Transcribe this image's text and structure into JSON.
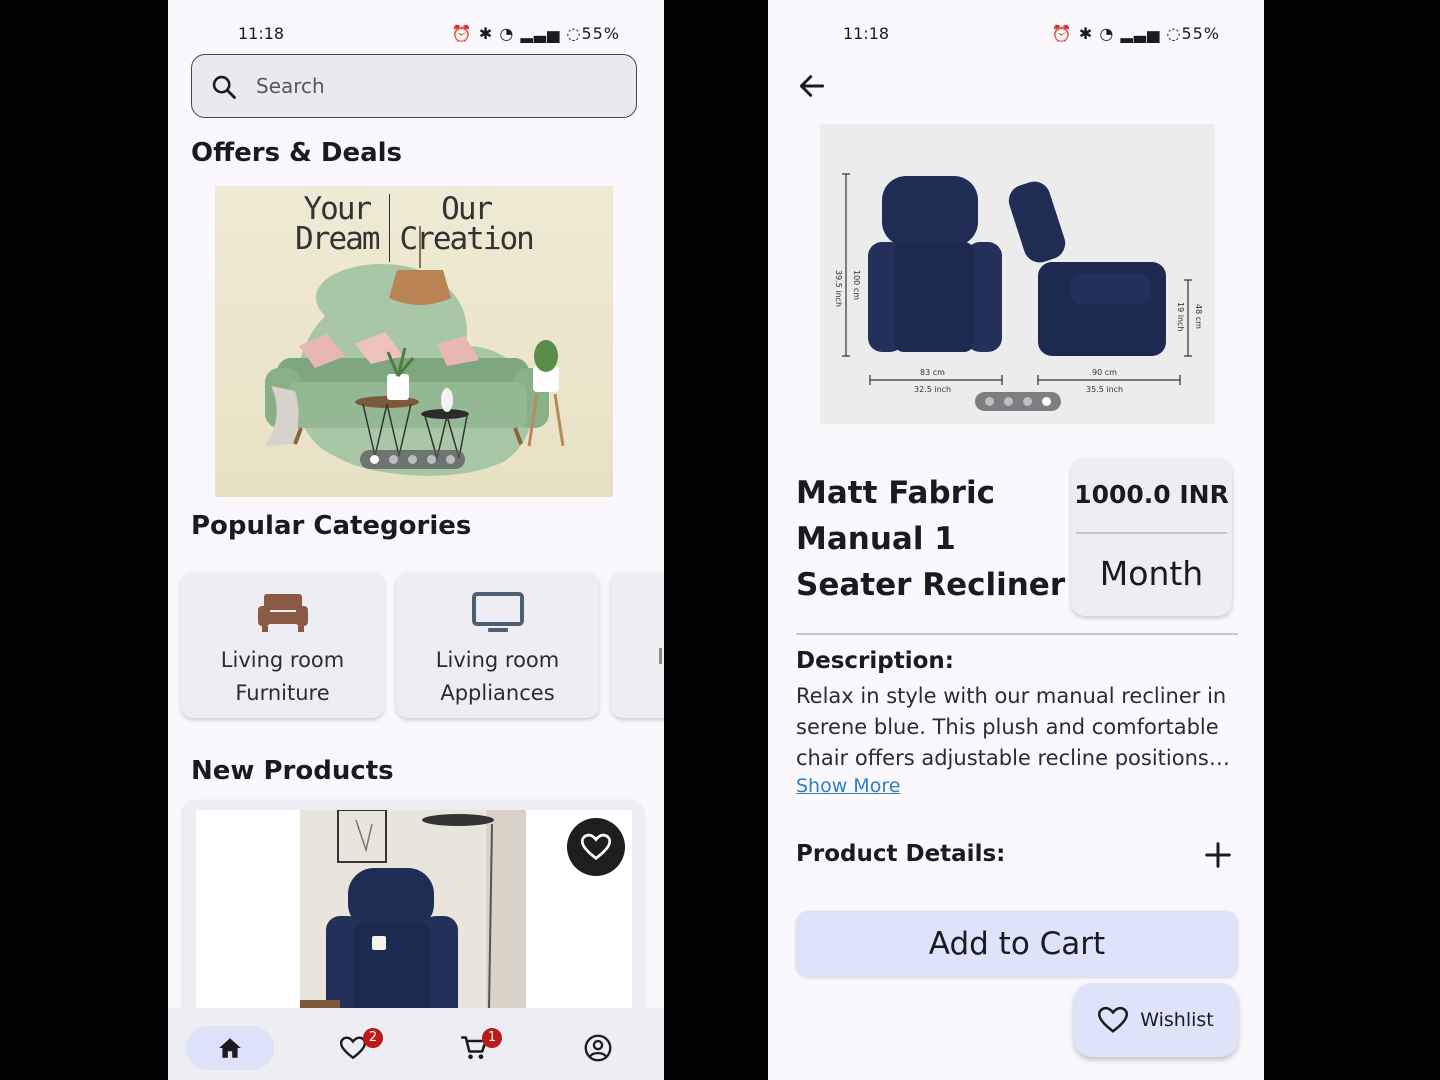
{
  "left_screen": {
    "status": {
      "time": "11:18",
      "battery": "55%"
    },
    "search": {
      "placeholder": "Search"
    },
    "offers_title": "Offers & Deals",
    "banner": {
      "line_left_1": "Your",
      "line_left_2": "Dream",
      "line_right_1": "Our",
      "line_right_2": "Creation"
    },
    "categories_title": "Popular Categories",
    "categories": [
      {
        "label_1": "Living room",
        "label_2": "Furniture",
        "icon": "sofa-icon"
      },
      {
        "label_1": "Living room",
        "label_2": "Appliances",
        "icon": "tv-icon"
      }
    ],
    "new_products_title": "New Products",
    "bottom_nav": {
      "wishlist_badge": "2",
      "cart_badge": "1"
    }
  },
  "right_screen": {
    "status": {
      "time": "11:18",
      "battery": "55%"
    },
    "hero_dims": {
      "height_cm": "100 cm",
      "height_inch": "39.5 inch",
      "width_cm": "83 cm",
      "width_inch": "32.5 inch",
      "depth_cm": "90 cm",
      "depth_inch": "35.5 inch",
      "seat_cm": "48 cm",
      "seat_inch": "19 inch"
    },
    "product": {
      "title": "Matt Fabric Manual 1 Seater Recliner",
      "price": "1000.0 INR",
      "period": "Month"
    },
    "description": {
      "title": "Description:",
      "text": "Relax in style with our manual recliner in serene blue. This plush and comfortable chair offers adjustable recline positions for ultimate relaxation.",
      "show_more": "Show More"
    },
    "details_title": "Product Details:",
    "add_to_cart": "Add to Cart",
    "wishlist": "Wishlist"
  },
  "colors": {
    "background": "#faf8fd",
    "surface": "#eeedf4",
    "primary_container": "#dde3f8",
    "badge": "#ba1a1a",
    "link": "#2f7fc2",
    "recliner_blue": "#1f2d55"
  }
}
